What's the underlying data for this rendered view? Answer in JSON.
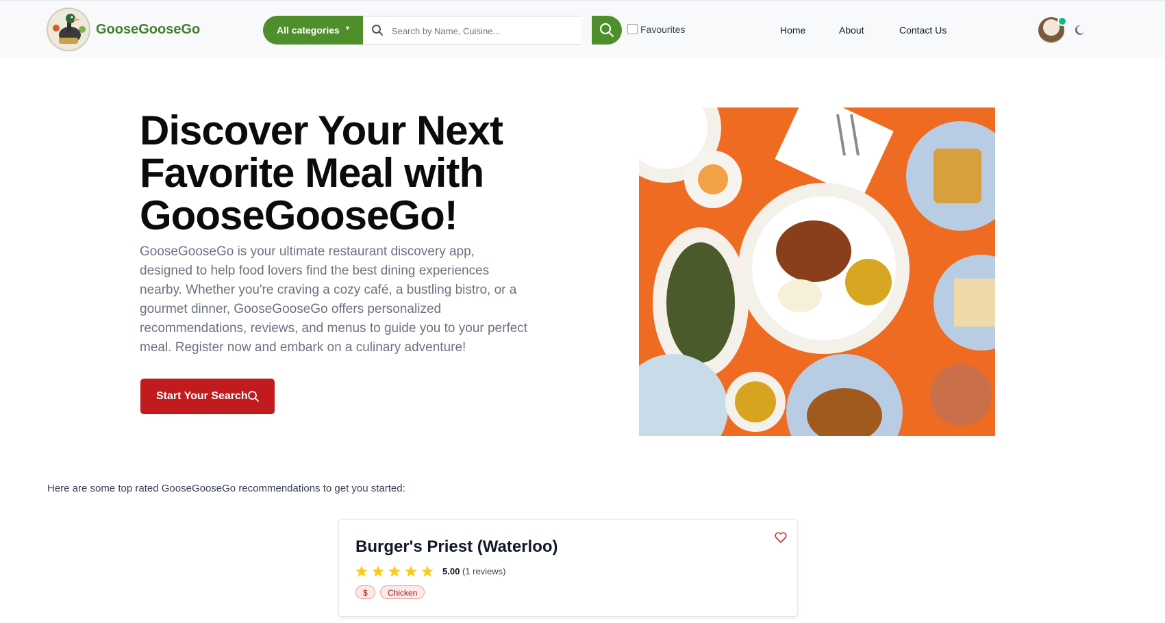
{
  "navbar": {
    "brand": "GooseGooseGo",
    "category_button": "All categories",
    "search_placeholder": "Search by Name, Cuisine...",
    "favourites_label": "Favourites",
    "links": [
      "Home",
      "About",
      "Contact Us"
    ]
  },
  "hero": {
    "title_lines": [
      "Discover Your Next",
      "Favorite Meal with",
      "GooseGooseGo!"
    ],
    "description": "GooseGooseGo is your ultimate restaurant discovery app, designed to help food lovers find the best dining experiences nearby. Whether you're craving a cozy café, a bustling bistro, or a gourmet dinner, GooseGooseGo offers personalized recommendations, reviews, and menus to guide you to your perfect meal. Register now and embark on a culinary adventure!",
    "cta_label": "Start Your Search"
  },
  "recommendations": {
    "intro": "Here are some top rated GooseGooseGo recommendations to get you started:",
    "cards": [
      {
        "name": "Burger's Priest (Waterloo)",
        "stars": 5,
        "rating": "5.00",
        "reviews": "(1 reviews)",
        "tags": [
          "$",
          "Chicken"
        ]
      }
    ]
  },
  "colors": {
    "brand_green": "#4e8f2b",
    "cta_red": "#c11b1f",
    "star_yellow": "#facc15"
  },
  "icons": [
    "search-icon",
    "chevron-down-icon",
    "moon-icon",
    "heart-icon",
    "star-icon"
  ]
}
